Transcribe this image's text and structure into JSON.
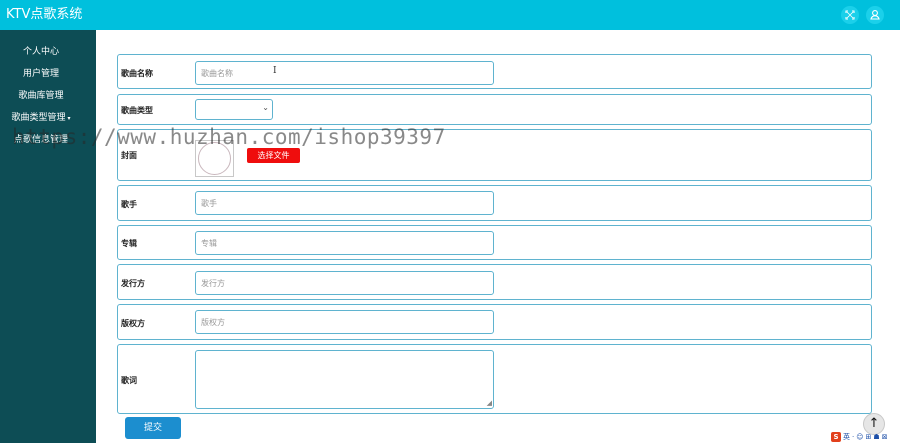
{
  "header": {
    "title": "KTV点歌系统",
    "icons": [
      "fullscreen-icon",
      "user-icon"
    ]
  },
  "sidebar": {
    "items": [
      {
        "label": "个人中心",
        "has_arrow": false
      },
      {
        "label": "用户管理",
        "has_arrow": false
      },
      {
        "label": "歌曲库管理",
        "has_arrow": false
      },
      {
        "label": "歌曲类型管理",
        "has_arrow": true,
        "arrow": "▾"
      },
      {
        "label": "点歌信息管理",
        "has_arrow": false
      }
    ]
  },
  "form": {
    "song_name": {
      "label": "歌曲名称",
      "placeholder": "歌曲名称"
    },
    "song_type": {
      "label": "歌曲类型",
      "value": "",
      "chevron": "⌄"
    },
    "cover": {
      "label": "封面",
      "button": "选择文件"
    },
    "singer": {
      "label": "歌手",
      "placeholder": "歌手"
    },
    "album": {
      "label": "专辑",
      "placeholder": "专辑"
    },
    "publisher": {
      "label": "发行方",
      "placeholder": "发行方"
    },
    "copyright": {
      "label": "版权方",
      "placeholder": "版权方"
    },
    "lyrics": {
      "label": "歌词",
      "value": ""
    },
    "submit_label": "提交"
  },
  "watermark": "https://www.huzhan.com/ishop39397",
  "ime": {
    "logo": "S",
    "items": [
      "英",
      "·",
      "☺",
      "⊞",
      "☗",
      "⊠"
    ]
  },
  "colors": {
    "topbar": "#00c0dd",
    "sidebar": "#0d4d55",
    "border": "#5fb3cf",
    "submit": "#1c8ecf",
    "file_button": "#ef0d0d"
  }
}
